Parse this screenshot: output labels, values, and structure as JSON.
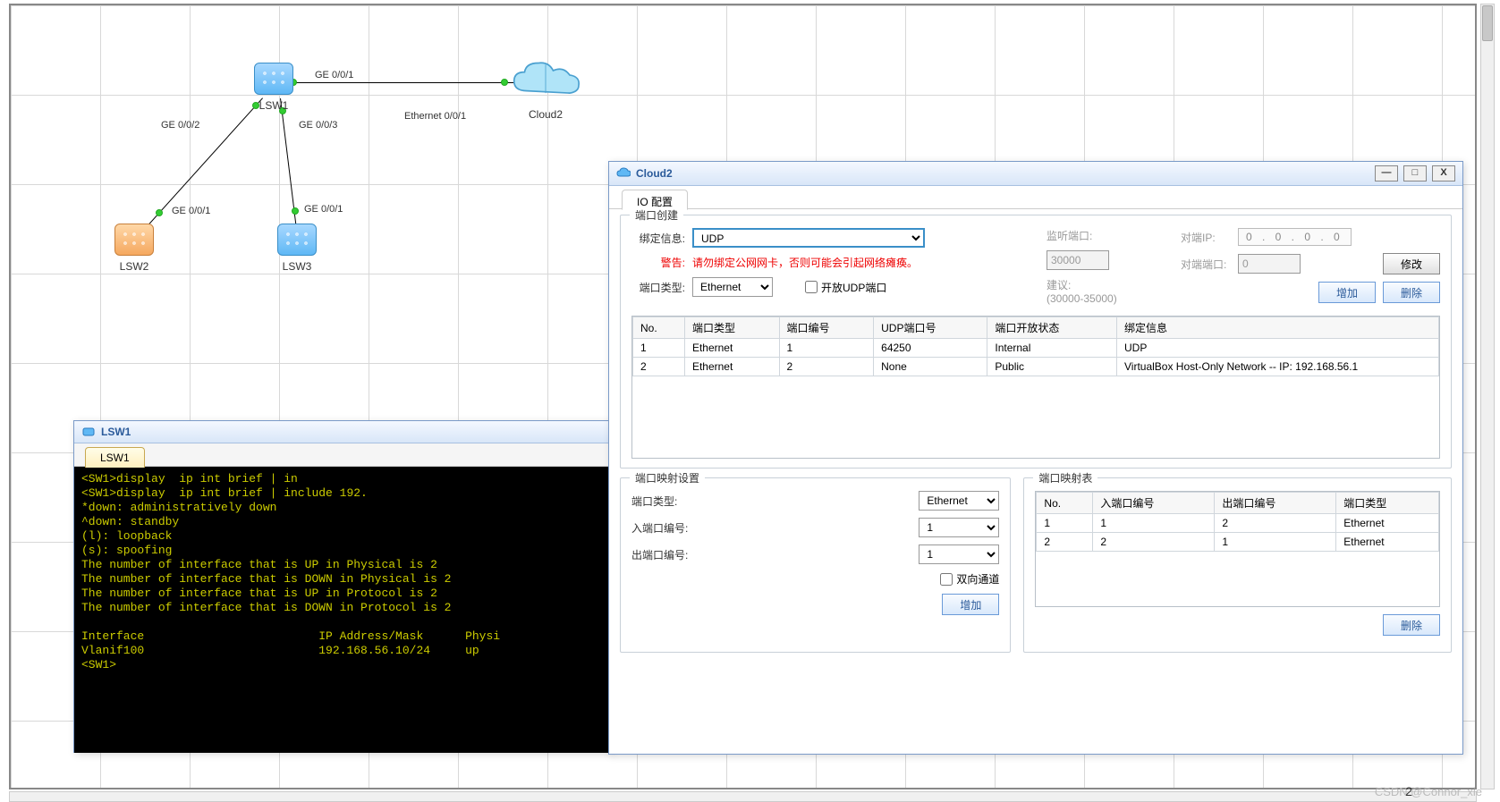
{
  "topology": {
    "nodes": {
      "lsw1": {
        "label": "LSW1"
      },
      "lsw2": {
        "label": "LSW2"
      },
      "lsw3": {
        "label": "LSW3"
      },
      "cloud2": {
        "label": "Cloud2"
      }
    },
    "link_labels": {
      "lsw1_cloud_ge": "GE 0/0/1",
      "lsw1_cloud_eth": "Ethernet 0/0/1",
      "lsw1_lsw2": "GE 0/0/2",
      "lsw1_lsw3": "GE 0/0/3",
      "lsw2_up": "GE 0/0/1",
      "lsw3_up": "GE 0/0/1"
    }
  },
  "lsw1_window": {
    "title": "LSW1",
    "tab": "LSW1",
    "terminal": "<SW1>display  ip int brief | in\n<SW1>display  ip int brief | include 192.\n*down: administratively down\n^down: standby\n(l): loopback\n(s): spoofing\nThe number of interface that is UP in Physical is 2\nThe number of interface that is DOWN in Physical is 2\nThe number of interface that is UP in Protocol is 2\nThe number of interface that is DOWN in Protocol is 2\n\nInterface                         IP Address/Mask      Physi\nVlanif100                         192.168.56.10/24     up\n<SW1>"
  },
  "cloud2_window": {
    "title": "Cloud2",
    "tab": "IO 配置",
    "port_create": {
      "legend": "端口创建",
      "bind_info_label": "绑定信息:",
      "bind_info_value": "UDP",
      "warning_label": "警告:",
      "warning_text": "请勿绑定公网网卡，否则可能会引起网络瘫痪。",
      "port_type_label": "端口类型:",
      "port_type_value": "Ethernet",
      "open_udp_label": "开放UDP端口",
      "listen_port_label": "监听端口:",
      "listen_port_value": "30000",
      "suggest_label": "建议:",
      "suggest_range": "(30000-35000)",
      "peer_ip_label": "对端IP:",
      "peer_ip_value": "0 . 0 . 0 . 0",
      "peer_port_label": "对端端口:",
      "peer_port_value": "0",
      "modify_btn": "修改",
      "add_btn": "增加",
      "delete_btn": "删除",
      "table": {
        "headers": [
          "No.",
          "端口类型",
          "端口编号",
          "UDP端口号",
          "端口开放状态",
          "绑定信息"
        ],
        "rows": [
          [
            "1",
            "Ethernet",
            "1",
            "64250",
            "Internal",
            "UDP"
          ],
          [
            "2",
            "Ethernet",
            "2",
            "None",
            "Public",
            "VirtualBox Host-Only Network -- IP: 192.168.56.1"
          ]
        ]
      }
    },
    "port_map_set": {
      "legend": "端口映射设置",
      "port_type_label": "端口类型:",
      "port_type_value": "Ethernet",
      "in_port_label": "入端口编号:",
      "in_port_value": "1",
      "out_port_label": "出端口编号:",
      "out_port_value": "1",
      "bidir_label": "双向通道",
      "add_btn": "增加"
    },
    "port_map_table": {
      "legend": "端口映射表",
      "headers": [
        "No.",
        "入端口编号",
        "出端口编号",
        "端口类型"
      ],
      "rows": [
        [
          "1",
          "1",
          "2",
          "Ethernet"
        ],
        [
          "2",
          "2",
          "1",
          "Ethernet"
        ]
      ],
      "delete_btn": "删除"
    }
  },
  "watermark": "CSDN @Connor_xie",
  "cursor_glyph": "2"
}
